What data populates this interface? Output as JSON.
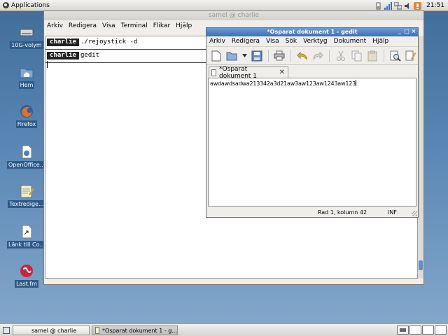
{
  "top_panel": {
    "apps_label": "Applications",
    "clock": "21:51"
  },
  "desktop": {
    "icons": [
      {
        "label": "10G-volym",
        "icon": "drive-icon"
      },
      {
        "label": "Hem",
        "icon": "home-folder-icon"
      },
      {
        "label": "Firefox",
        "icon": "firefox-icon"
      },
      {
        "label": "OpenOffice...",
        "icon": "openoffice-icon"
      },
      {
        "label": "Textredige...",
        "icon": "text-editor-icon"
      },
      {
        "label": "Länk till Co...",
        "icon": "link-document-icon"
      },
      {
        "label": "Last.fm",
        "icon": "lastfm-icon"
      }
    ]
  },
  "terminal": {
    "title": "samel @ charlie",
    "menu": [
      "Arkiv",
      "Redigera",
      "Visa",
      "Terminal",
      "Flikar",
      "Hjälp"
    ],
    "tabs": [
      {
        "label": "charlie",
        "text": "./rejoystick -d"
      },
      {
        "label": "charlie",
        "text": "gedit"
      }
    ]
  },
  "gedit": {
    "title": "*Osparat dokument 1 - gedit",
    "menu": [
      "Arkiv",
      "Redigera",
      "Visa",
      "Sök",
      "Verktyg",
      "Dokument",
      "Hjälp"
    ],
    "toolbar": [
      "new-document-icon",
      "open-folder-icon",
      "dropdown-arrow-icon",
      "save-icon",
      "print-icon",
      "undo-icon",
      "redo-icon",
      "cut-icon",
      "copy-icon",
      "paste-icon",
      "find-icon",
      "replace-icon"
    ],
    "tab_label": "*Osparat dokument 1",
    "content": "awdawdsadwa213342a3d21aw3aw123aw1243aw123",
    "status_position": "Rad 1, kolumn 42",
    "status_mode": "INF"
  },
  "taskbar": {
    "items": [
      "samel @ charlie",
      "*Osparat dokument 1 - g..."
    ],
    "workspaces": 4
  },
  "colors": {
    "desktop": "#4f7dac",
    "title_active": "#4f7fbd",
    "title_inactive": "#d3d1cc"
  }
}
